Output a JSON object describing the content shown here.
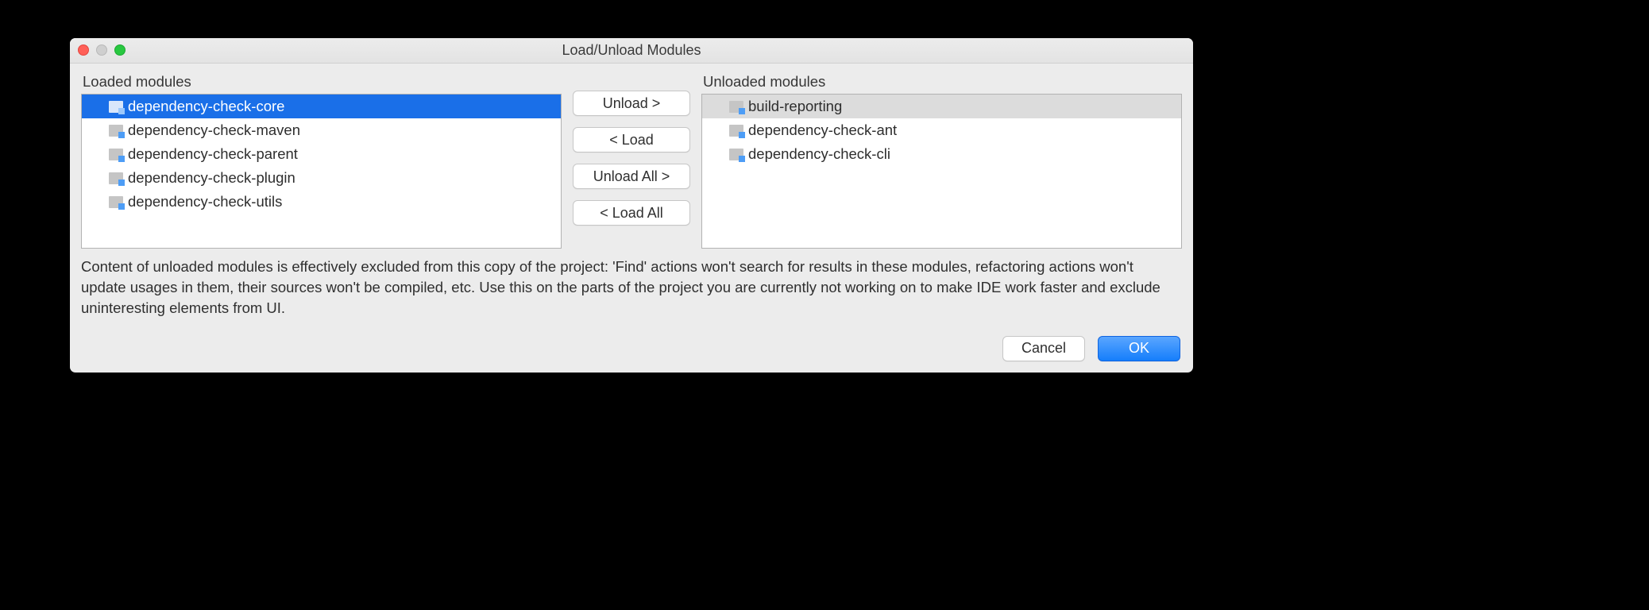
{
  "dialog": {
    "title": "Load/Unload Modules"
  },
  "loaded": {
    "label": "Loaded modules",
    "items": [
      {
        "name": "dependency-check-core",
        "selected": true
      },
      {
        "name": "dependency-check-maven",
        "selected": false
      },
      {
        "name": "dependency-check-parent",
        "selected": false
      },
      {
        "name": "dependency-check-plugin",
        "selected": false
      },
      {
        "name": "dependency-check-utils",
        "selected": false
      }
    ]
  },
  "unloaded": {
    "label": "Unloaded modules",
    "items": [
      {
        "name": "build-reporting",
        "selected": true
      },
      {
        "name": "dependency-check-ant",
        "selected": false
      },
      {
        "name": "dependency-check-cli",
        "selected": false
      }
    ]
  },
  "buttons": {
    "unload": "Unload >",
    "load": "< Load",
    "unloadAll": "Unload All >",
    "loadAll": "< Load All",
    "cancel": "Cancel",
    "ok": "OK"
  },
  "description": "Content of unloaded modules is effectively excluded from this copy of the project: 'Find' actions won't search for results in these modules, refactoring actions won't update usages in them, their sources won't be compiled, etc. Use this on the parts of the project you are currently not working on to make IDE work faster and exclude uninteresting elements from UI."
}
